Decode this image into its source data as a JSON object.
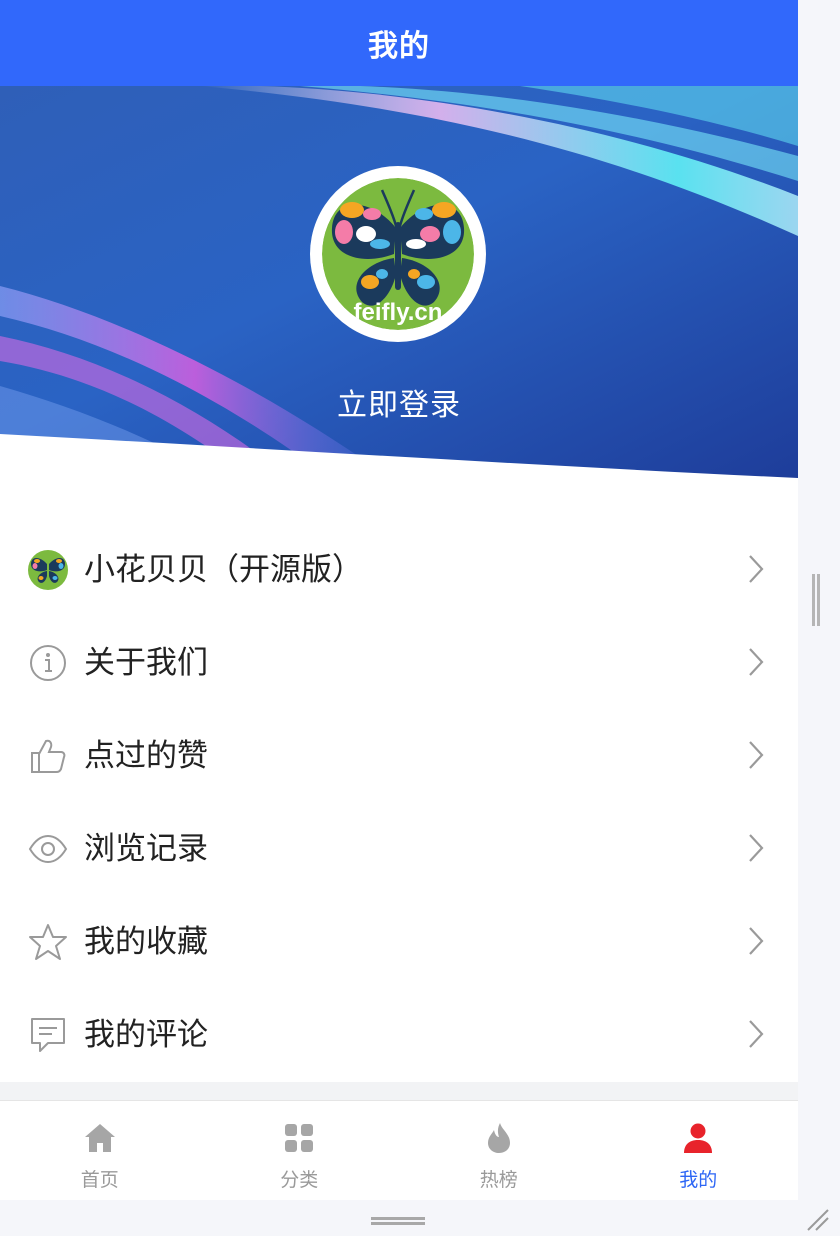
{
  "header": {
    "title": "我的"
  },
  "profile": {
    "login_label": "立即登录",
    "avatar_text": "feifly.cn"
  },
  "menu": {
    "items": [
      {
        "label": "小花贝贝（开源版）",
        "icon": "app-logo-icon"
      },
      {
        "label": "关于我们",
        "icon": "info-icon"
      },
      {
        "label": "点过的赞",
        "icon": "thumbs-up-icon"
      },
      {
        "label": "浏览记录",
        "icon": "eye-icon"
      },
      {
        "label": "我的收藏",
        "icon": "star-icon"
      },
      {
        "label": "我的评论",
        "icon": "comment-icon"
      }
    ]
  },
  "tabbar": {
    "tabs": [
      {
        "label": "首页",
        "icon": "home-icon",
        "active": false
      },
      {
        "label": "分类",
        "icon": "grid-icon",
        "active": false
      },
      {
        "label": "热榜",
        "icon": "flame-icon",
        "active": false
      },
      {
        "label": "我的",
        "icon": "user-icon",
        "active": true
      }
    ]
  },
  "colors": {
    "accent": "#3168fb",
    "active_tab": "#2d66f5",
    "user_tab_icon": "#e8232b",
    "inactive": "#9a9a9a"
  }
}
